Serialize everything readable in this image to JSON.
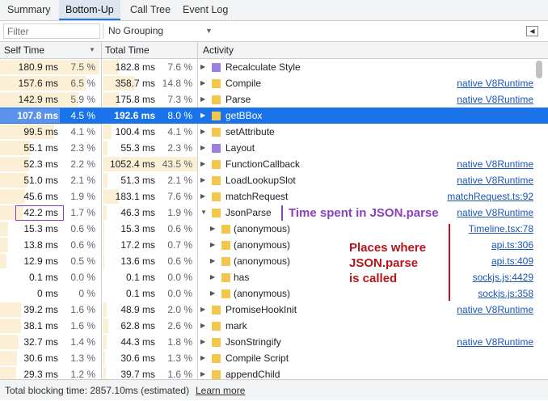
{
  "tabs": [
    "Summary",
    "Bottom-Up",
    "Call Tree",
    "Event Log"
  ],
  "toolbar": {
    "filter_placeholder": "Filter",
    "grouping": "No Grouping"
  },
  "columns": {
    "self_time": "Self Time",
    "total_time": "Total Time",
    "activity": "Activity"
  },
  "colors": {
    "purple": "#9b7fe0",
    "yellow": "#f3c74e",
    "selection": "#1a73e8",
    "bar": "#fbefd5",
    "annotation_purple": "#8b3fbf",
    "annotation_red": "#b3161b"
  },
  "rows": [
    {
      "self": "180.9 ms",
      "self_pct": "7.5 %",
      "self_frac": 0.075,
      "total": "182.8 ms",
      "total_pct": "7.6 %",
      "total_frac": 0.076,
      "indent": 0,
      "expander": "right",
      "color": "purple",
      "name": "Recalculate Style",
      "link": ""
    },
    {
      "self": "157.6 ms",
      "self_pct": "6.5 %",
      "self_frac": 0.065,
      "total": "358.7 ms",
      "total_pct": "14.8 %",
      "total_frac": 0.148,
      "indent": 0,
      "expander": "right",
      "color": "yellow",
      "name": "Compile",
      "link": "native V8Runtime"
    },
    {
      "self": "142.9 ms",
      "self_pct": "5.9 %",
      "self_frac": 0.059,
      "total": "175.8 ms",
      "total_pct": "7.3 %",
      "total_frac": 0.073,
      "indent": 0,
      "expander": "right",
      "color": "yellow",
      "name": "Parse",
      "link": "native V8Runtime"
    },
    {
      "self": "107.8 ms",
      "self_pct": "4.5 %",
      "self_frac": 0.045,
      "total": "192.6 ms",
      "total_pct": "8.0 %",
      "total_frac": 0.08,
      "indent": 0,
      "expander": "right",
      "color": "yellow",
      "name": "getBBox",
      "link": "",
      "selected": true
    },
    {
      "self": "99.5 ms",
      "self_pct": "4.1 %",
      "self_frac": 0.041,
      "total": "100.4 ms",
      "total_pct": "4.1 %",
      "total_frac": 0.041,
      "indent": 0,
      "expander": "right",
      "color": "yellow",
      "name": "setAttribute",
      "link": ""
    },
    {
      "self": "55.1 ms",
      "self_pct": "2.3 %",
      "self_frac": 0.023,
      "total": "55.3 ms",
      "total_pct": "2.3 %",
      "total_frac": 0.023,
      "indent": 0,
      "expander": "right",
      "color": "purple",
      "name": "Layout",
      "link": ""
    },
    {
      "self": "52.3 ms",
      "self_pct": "2.2 %",
      "self_frac": 0.022,
      "total": "1052.4 ms",
      "total_pct": "43.5 %",
      "total_frac": 0.435,
      "indent": 0,
      "expander": "right",
      "color": "yellow",
      "name": "FunctionCallback",
      "link": "native V8Runtime"
    },
    {
      "self": "51.0 ms",
      "self_pct": "2.1 %",
      "self_frac": 0.021,
      "total": "51.3 ms",
      "total_pct": "2.1 %",
      "total_frac": 0.021,
      "indent": 0,
      "expander": "right",
      "color": "yellow",
      "name": "LoadLookupSlot",
      "link": "native V8Runtime"
    },
    {
      "self": "45.6 ms",
      "self_pct": "1.9 %",
      "self_frac": 0.019,
      "total": "183.1 ms",
      "total_pct": "7.6 %",
      "total_frac": 0.076,
      "indent": 0,
      "expander": "right",
      "color": "yellow",
      "name": "matchRequest",
      "link": "matchRequest.ts:92"
    },
    {
      "self": "42.2 ms",
      "self_pct": "1.7 %",
      "self_frac": 0.017,
      "total": "46.3 ms",
      "total_pct": "1.9 %",
      "total_frac": 0.019,
      "indent": 0,
      "expander": "down",
      "color": "yellow",
      "name": "JsonParse",
      "link": "native V8Runtime"
    },
    {
      "self": "15.3 ms",
      "self_pct": "0.6 %",
      "self_frac": 0.006,
      "total": "15.3 ms",
      "total_pct": "0.6 %",
      "total_frac": 0.006,
      "indent": 1,
      "expander": "right",
      "color": "yellow",
      "name": "(anonymous)",
      "link": "Timeline.tsx:78"
    },
    {
      "self": "13.8 ms",
      "self_pct": "0.6 %",
      "self_frac": 0.006,
      "total": "17.2 ms",
      "total_pct": "0.7 %",
      "total_frac": 0.007,
      "indent": 1,
      "expander": "right",
      "color": "yellow",
      "name": "(anonymous)",
      "link": "api.ts:306"
    },
    {
      "self": "12.9 ms",
      "self_pct": "0.5 %",
      "self_frac": 0.005,
      "total": "13.6 ms",
      "total_pct": "0.6 %",
      "total_frac": 0.006,
      "indent": 1,
      "expander": "right",
      "color": "yellow",
      "name": "(anonymous)",
      "link": "api.ts:409"
    },
    {
      "self": "0.1 ms",
      "self_pct": "0.0 %",
      "self_frac": 0.0,
      "total": "0.1 ms",
      "total_pct": "0.0 %",
      "total_frac": 0.0,
      "indent": 1,
      "expander": "right",
      "color": "yellow",
      "name": "has",
      "link": "sockjs.js:4429"
    },
    {
      "self": "0 ms",
      "self_pct": "0 %",
      "self_frac": 0.0,
      "total": "0.1 ms",
      "total_pct": "0.0 %",
      "total_frac": 0.0,
      "indent": 1,
      "expander": "right",
      "color": "yellow",
      "name": "(anonymous)",
      "link": "sockjs.js:358"
    },
    {
      "self": "39.2 ms",
      "self_pct": "1.6 %",
      "self_frac": 0.016,
      "total": "48.9 ms",
      "total_pct": "2.0 %",
      "total_frac": 0.02,
      "indent": 0,
      "expander": "right",
      "color": "yellow",
      "name": "PromiseHookInit",
      "link": "native V8Runtime"
    },
    {
      "self": "38.1 ms",
      "self_pct": "1.6 %",
      "self_frac": 0.016,
      "total": "62.8 ms",
      "total_pct": "2.6 %",
      "total_frac": 0.026,
      "indent": 0,
      "expander": "right",
      "color": "yellow",
      "name": "mark",
      "link": ""
    },
    {
      "self": "32.7 ms",
      "self_pct": "1.4 %",
      "self_frac": 0.014,
      "total": "44.3 ms",
      "total_pct": "1.8 %",
      "total_frac": 0.018,
      "indent": 0,
      "expander": "right",
      "color": "yellow",
      "name": "JsonStringify",
      "link": "native V8Runtime"
    },
    {
      "self": "30.6 ms",
      "self_pct": "1.3 %",
      "self_frac": 0.013,
      "total": "30.6 ms",
      "total_pct": "1.3 %",
      "total_frac": 0.013,
      "indent": 0,
      "expander": "right",
      "color": "yellow",
      "name": "Compile Script",
      "link": ""
    },
    {
      "self": "29.3 ms",
      "self_pct": "1.2 %",
      "self_frac": 0.012,
      "total": "39.7 ms",
      "total_pct": "1.6 %",
      "total_frac": 0.016,
      "indent": 0,
      "expander": "right",
      "color": "yellow",
      "name": "appendChild",
      "link": ""
    }
  ],
  "annotations": {
    "json_time": "Time spent in JSON.parse",
    "places": [
      "Places where",
      "JSON.parse",
      "is called"
    ]
  },
  "footer": {
    "text": "Total blocking time: 2857.10ms (estimated)",
    "link": "Learn more"
  }
}
